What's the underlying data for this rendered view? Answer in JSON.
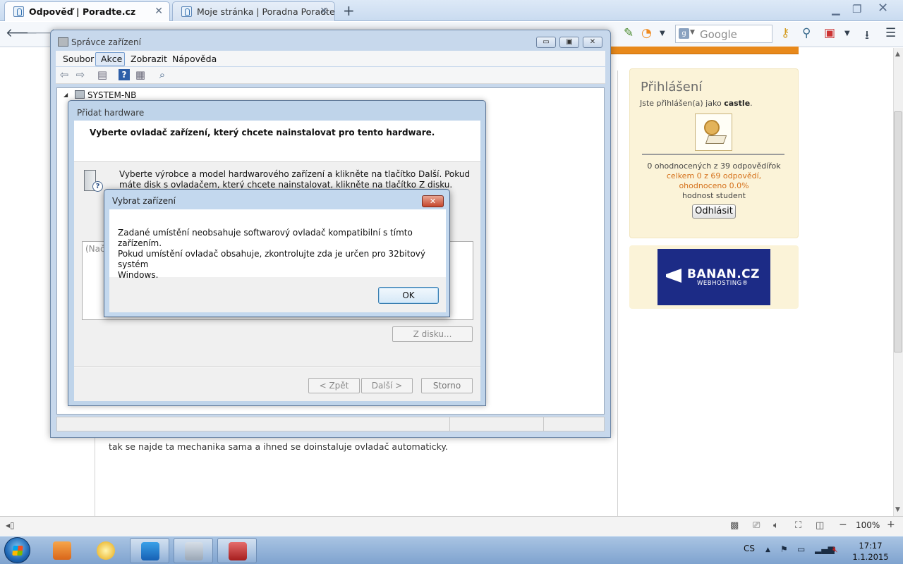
{
  "browser": {
    "tabs": [
      {
        "label": "Odpověď | Poradte.cz",
        "active": true
      },
      {
        "label": "Moje stránka | Poradna Poradte.cz",
        "active": false
      }
    ],
    "new_tab_glyph": "+",
    "search_placeholder": "Google",
    "zoom": "100%"
  },
  "page": {
    "answer_text": "tak se najde ta mechanika sama a ihned se doinstaluje ovladač automaticky.",
    "login": {
      "title": "Přihlášení",
      "logged_in_prefix": "Jste přihlášen(a) jako",
      "username": "castle",
      "rated_line": "0 ohodnocených z 39 odpovědířok",
      "total_line": "celkem 0 z 69 odpovědí,",
      "pct_line": "ohodnoceno 0.0%",
      "rank_line": "hodnost student",
      "logout_label": "Odhlásit"
    },
    "ad": {
      "brand": "BANAN.CZ",
      "sub": "WEBHOSTING®"
    }
  },
  "device_manager": {
    "title": "Správce zařízení",
    "menu": [
      "Soubor",
      "Akce",
      "Zobrazit",
      "Nápověda"
    ],
    "tree_root": "SYSTEM-NB",
    "caption_buttons": {
      "minimize": "▭",
      "maximize": "▣",
      "close": "✕"
    }
  },
  "wizard": {
    "title": "Přidat hardware",
    "heading": "Vyberte ovladač zařízení, který chcete nainstalovat pro tento hardware.",
    "description": "Vyberte výrobce a model hardwarového zařízení a klikněte na tlačítko Další. Pokud máte disk s ovladačem, který chcete nainstalovat, klikněte na tlačítko Z disku.",
    "list_text": "(Nač",
    "from_disk": "Z disku...",
    "back": "< Zpět",
    "next": "Další >",
    "cancel": "Storno"
  },
  "error_dialog": {
    "title": "Vybrat zařízení",
    "message_line1": "Zadané umístění neobsahuje softwarový ovladač kompatibilní s tímto zařízením.",
    "message_line2": "Pokud umístění ovladač obsahuje, zkontrolujte zda je určen pro 32bitový systém",
    "message_line3": "Windows.",
    "ok": "OK",
    "close_glyph": "✕"
  },
  "taskbar": {
    "language": "CS",
    "time": "17:17",
    "date": "1.1.2015"
  },
  "colors": {
    "accent_orange": "#e8891b",
    "login_bg": "#fbf3d8",
    "ad_blue": "#1c2b86",
    "close_red": "#c5462c"
  }
}
